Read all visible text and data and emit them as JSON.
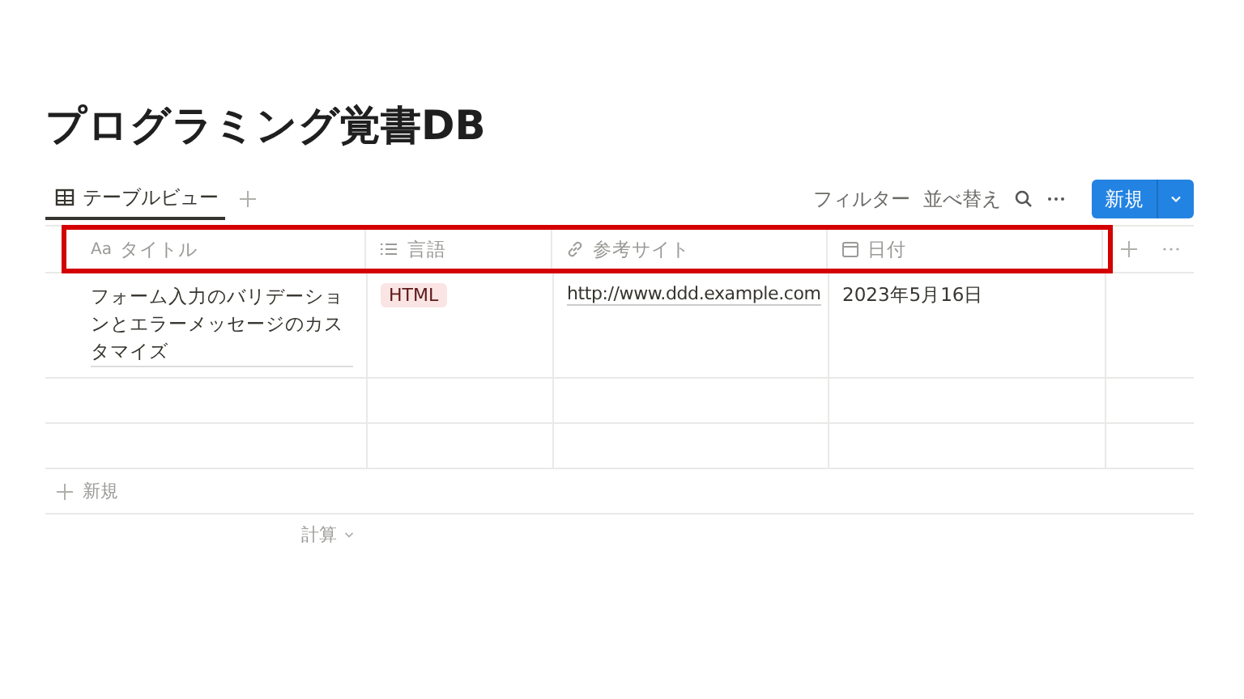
{
  "page_title": "プログラミング覚書DB",
  "view_tab": {
    "label": "テーブルビュー",
    "selected": true
  },
  "toolbar": {
    "filter": "フィルター",
    "sort": "並べ替え",
    "new_button": "新規"
  },
  "table": {
    "header_highlighted": true,
    "columns": [
      {
        "kind": "title",
        "prefix": "Aa",
        "label": "タイトル"
      },
      {
        "kind": "select",
        "label": "言語"
      },
      {
        "kind": "url",
        "label": "参考サイト"
      },
      {
        "kind": "date",
        "label": "日付"
      }
    ],
    "rows": [
      {
        "kind": "filled",
        "title": "フォーム入力のバリデーションとエラーメッセージのカスタマイズ",
        "tag": {
          "label": "HTML",
          "color": "#fbe4e4"
        },
        "url": "http://www.ddd.example.com",
        "date": "2023年5月16日"
      },
      {
        "kind": "blank"
      },
      {
        "kind": "blank"
      }
    ],
    "new_row": "新規",
    "calc": "計算"
  }
}
